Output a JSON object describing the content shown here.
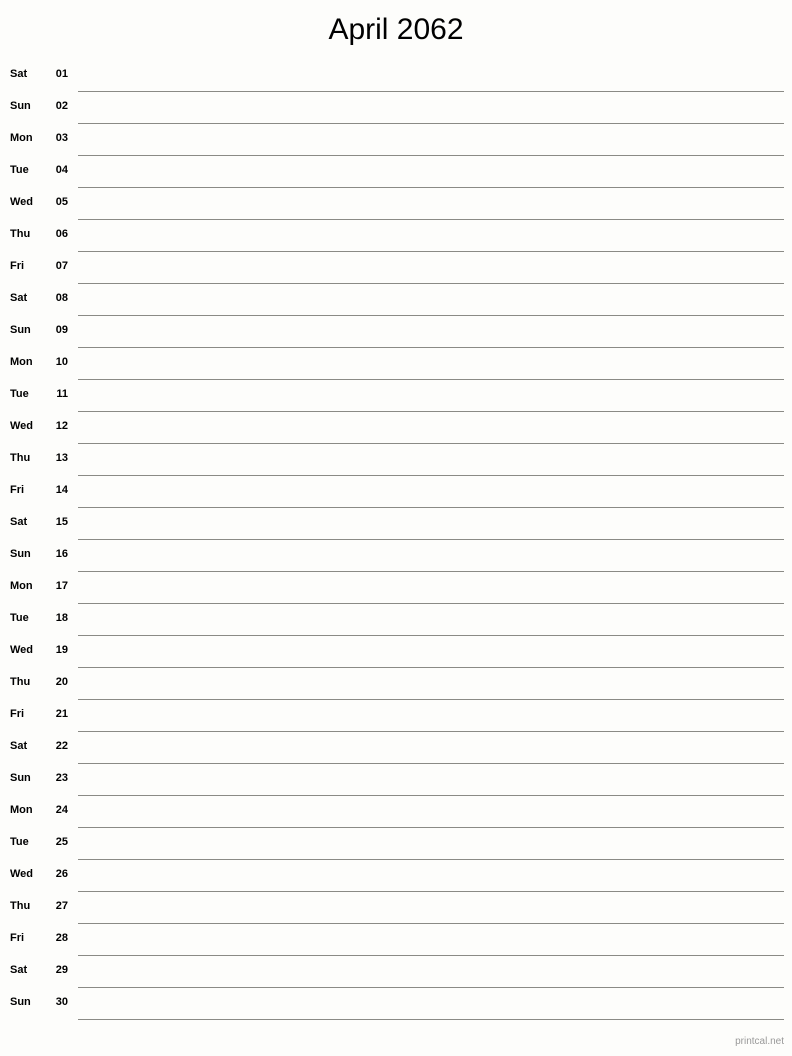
{
  "page": {
    "title": "April 2062",
    "background_color": "#fdfdfb",
    "rule_color": "#8a8a85"
  },
  "footer": {
    "label": "printcal.net",
    "color": "#999999"
  },
  "days": [
    {
      "weekday": "Sat",
      "number": "01"
    },
    {
      "weekday": "Sun",
      "number": "02"
    },
    {
      "weekday": "Mon",
      "number": "03"
    },
    {
      "weekday": "Tue",
      "number": "04"
    },
    {
      "weekday": "Wed",
      "number": "05"
    },
    {
      "weekday": "Thu",
      "number": "06"
    },
    {
      "weekday": "Fri",
      "number": "07"
    },
    {
      "weekday": "Sat",
      "number": "08"
    },
    {
      "weekday": "Sun",
      "number": "09"
    },
    {
      "weekday": "Mon",
      "number": "10"
    },
    {
      "weekday": "Tue",
      "number": "11"
    },
    {
      "weekday": "Wed",
      "number": "12"
    },
    {
      "weekday": "Thu",
      "number": "13"
    },
    {
      "weekday": "Fri",
      "number": "14"
    },
    {
      "weekday": "Sat",
      "number": "15"
    },
    {
      "weekday": "Sun",
      "number": "16"
    },
    {
      "weekday": "Mon",
      "number": "17"
    },
    {
      "weekday": "Tue",
      "number": "18"
    },
    {
      "weekday": "Wed",
      "number": "19"
    },
    {
      "weekday": "Thu",
      "number": "20"
    },
    {
      "weekday": "Fri",
      "number": "21"
    },
    {
      "weekday": "Sat",
      "number": "22"
    },
    {
      "weekday": "Sun",
      "number": "23"
    },
    {
      "weekday": "Mon",
      "number": "24"
    },
    {
      "weekday": "Tue",
      "number": "25"
    },
    {
      "weekday": "Wed",
      "number": "26"
    },
    {
      "weekday": "Thu",
      "number": "27"
    },
    {
      "weekday": "Fri",
      "number": "28"
    },
    {
      "weekday": "Sat",
      "number": "29"
    },
    {
      "weekday": "Sun",
      "number": "30"
    }
  ]
}
